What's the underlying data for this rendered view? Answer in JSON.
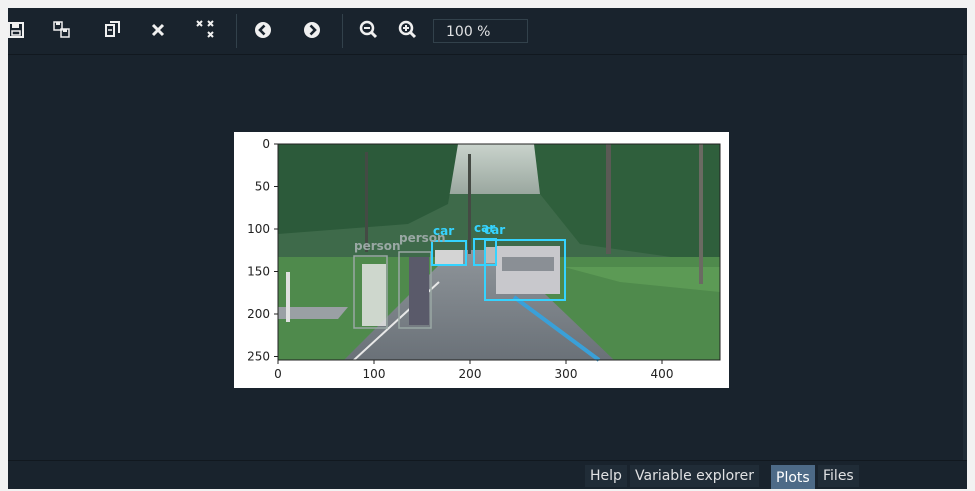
{
  "toolbar": {
    "buttons": [
      {
        "name": "save-icon"
      },
      {
        "name": "save-all-icon"
      },
      {
        "name": "copy-icon"
      },
      {
        "name": "close-icon"
      },
      {
        "name": "close-all-icon"
      },
      {
        "name": "previous-icon"
      },
      {
        "name": "next-icon"
      },
      {
        "name": "zoom-out-icon"
      },
      {
        "name": "zoom-in-icon"
      }
    ],
    "zoom_value": "100 %"
  },
  "plot": {
    "x_ticks": [
      "0",
      "100",
      "200",
      "300",
      "400"
    ],
    "y_ticks": [
      "0",
      "50",
      "100",
      "150",
      "200",
      "250"
    ],
    "detections": [
      {
        "label": "person",
        "color": "#9aa8a4"
      },
      {
        "label": "person",
        "color": "#9aa8a4"
      },
      {
        "label": "car",
        "color": "#35d3ff"
      },
      {
        "label": "car",
        "color": "#35d3ff"
      },
      {
        "label": "car",
        "color": "#35d3ff"
      }
    ]
  },
  "tabs": [
    {
      "label": "Help",
      "active": false
    },
    {
      "label": "Variable explorer",
      "active": false
    },
    {
      "label": "Plots",
      "active": true
    },
    {
      "label": "Files",
      "active": false
    }
  ],
  "colors": {
    "background": "#19232d",
    "active_tab": "#4d6a87",
    "box_person": "#9aa8a4",
    "box_car": "#35d3ff"
  }
}
